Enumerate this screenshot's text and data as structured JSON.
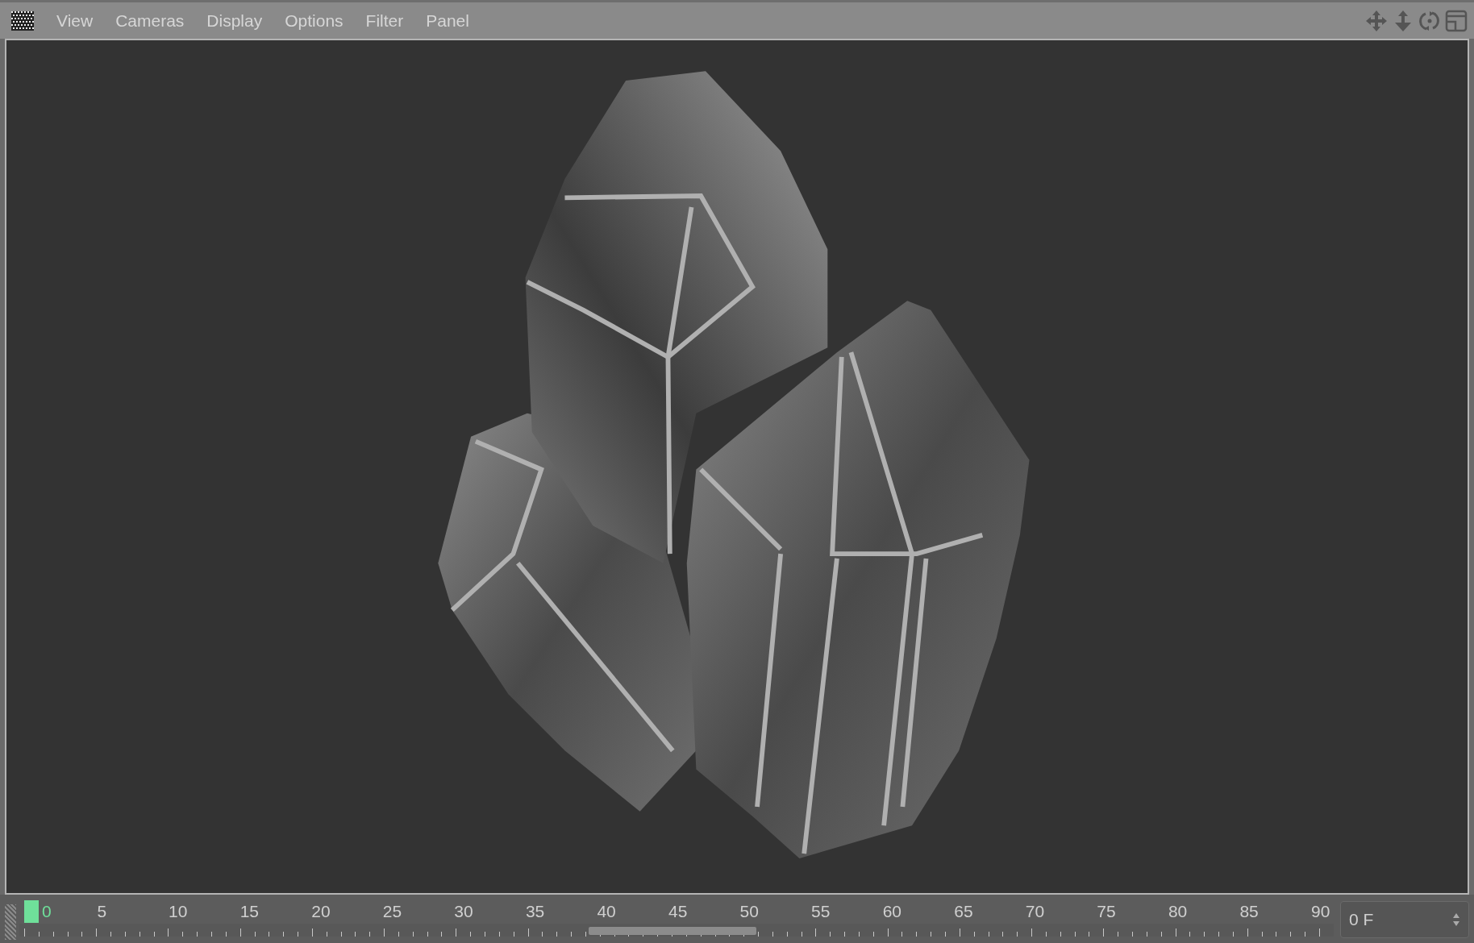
{
  "menu_bar": {
    "items": [
      "View",
      "Cameras",
      "Display",
      "Options",
      "Filter",
      "Panel"
    ]
  },
  "timeline": {
    "labels": [
      {
        "text": "0",
        "selected": true
      },
      {
        "text": "5",
        "selected": false
      },
      {
        "text": "10",
        "selected": false
      },
      {
        "text": "15",
        "selected": false
      },
      {
        "text": "20",
        "selected": false
      },
      {
        "text": "25",
        "selected": false
      },
      {
        "text": "30",
        "selected": false
      },
      {
        "text": "35",
        "selected": false
      },
      {
        "text": "40",
        "selected": false
      },
      {
        "text": "45",
        "selected": false
      },
      {
        "text": "50",
        "selected": false
      },
      {
        "text": "55",
        "selected": false
      },
      {
        "text": "60",
        "selected": false
      },
      {
        "text": "65",
        "selected": false
      },
      {
        "text": "70",
        "selected": false
      },
      {
        "text": "75",
        "selected": false
      },
      {
        "text": "80",
        "selected": false
      },
      {
        "text": "85",
        "selected": false
      },
      {
        "text": "90",
        "selected": false
      }
    ],
    "frame_field": {
      "value": "0 F"
    }
  }
}
